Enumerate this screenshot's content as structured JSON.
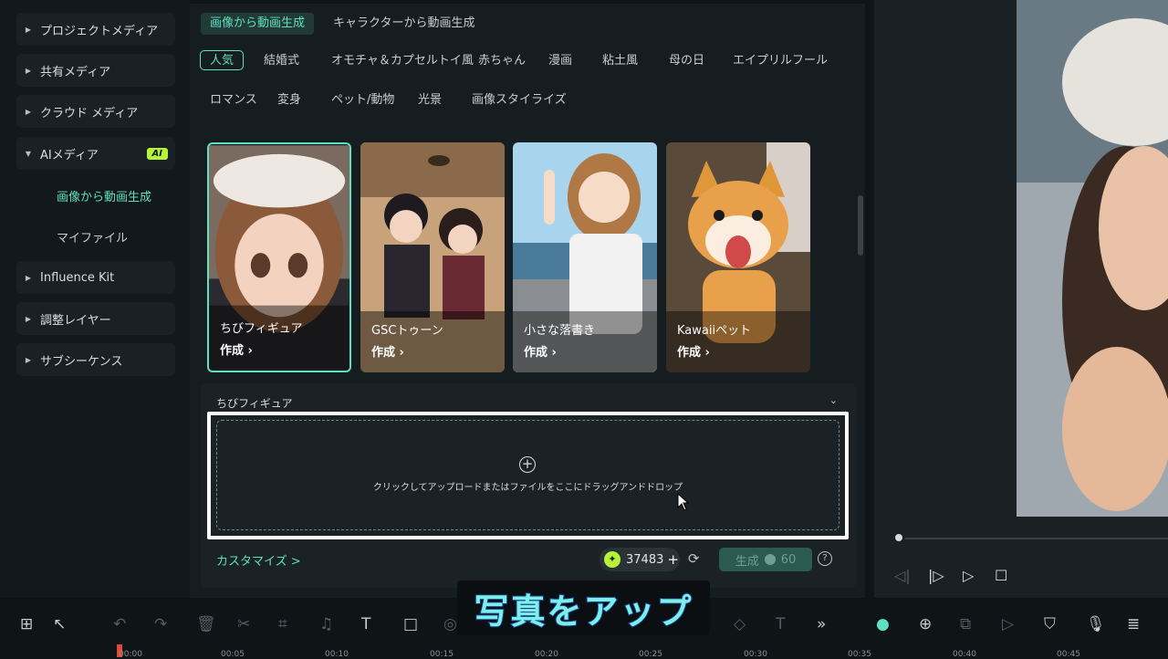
{
  "sidebar": {
    "items": [
      {
        "label": "プロジェクトメディア"
      },
      {
        "label": "共有メディア"
      },
      {
        "label": "クラウド メディア"
      },
      {
        "label": "AIメディア",
        "badge": "AI"
      },
      {
        "label": "Influence Kit"
      },
      {
        "label": "調整レイヤー"
      },
      {
        "label": "サブシーケンス"
      }
    ],
    "sub_items": [
      {
        "label": "画像から動画生成"
      },
      {
        "label": "マイファイル"
      }
    ]
  },
  "main": {
    "tabs": [
      {
        "label": "画像から動画生成"
      },
      {
        "label": "キャラクターから動画生成"
      }
    ],
    "chips": [
      "人気",
      "結婚式",
      "オモチャ＆カプセルトイ風",
      "赤ちゃん",
      "漫画",
      "粘土風",
      "母の日",
      "エイプリルフール",
      "ロマンス",
      "変身",
      "ペット/動物",
      "光景",
      "画像スタイライズ"
    ],
    "cards": [
      {
        "label": "ちびフィギュア",
        "action": "作成 ›"
      },
      {
        "label": "GSCトゥーン",
        "action": "作成 ›"
      },
      {
        "label": "小さな落書き",
        "action": "作成 ›"
      },
      {
        "label": "Kawaiiペット",
        "action": "作成 ›"
      }
    ],
    "panel": {
      "title": "ちびフィギュア",
      "drop_text": "クリックしてアップロードまたはファイルをここにドラッグアンドドロップ",
      "customize": "カスタマイズ >",
      "credits": "37483",
      "generate_label": "生成",
      "generate_cost": "60"
    }
  },
  "caption": "写真をアップ",
  "timeline": {
    "ticks": [
      "00:00",
      "00:05",
      "00:10",
      "00:15",
      "00:20",
      "00:25",
      "00:30",
      "00:35",
      "00:40",
      "00:45"
    ]
  },
  "colors": {
    "accent": "#5fe0c0",
    "ai_badge": "#b6f23a",
    "panel_bg": "#161d21"
  }
}
